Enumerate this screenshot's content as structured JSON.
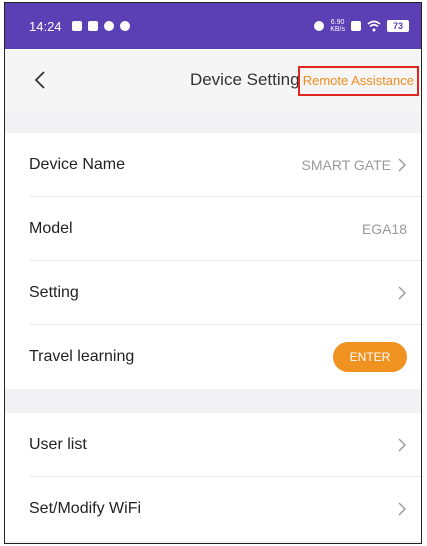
{
  "status_bar": {
    "time": "14:24",
    "speed": "6.90\nKB/s",
    "battery": "73"
  },
  "header": {
    "title": "Device Settings",
    "remote_label": "Remote Assistance",
    "highlight_color": "#e0281e",
    "accent_color": "#f08c1c"
  },
  "group1": {
    "rows": [
      {
        "label": "Device Name",
        "value": "SMART GATE"
      },
      {
        "label": "Model",
        "value": "EGA18"
      },
      {
        "label": "Setting",
        "value": ""
      },
      {
        "label": "Travel learning",
        "button": "ENTER"
      }
    ]
  },
  "group2": {
    "rows": [
      {
        "label": "User list"
      },
      {
        "label": "Set/Modify WiFi"
      }
    ]
  }
}
